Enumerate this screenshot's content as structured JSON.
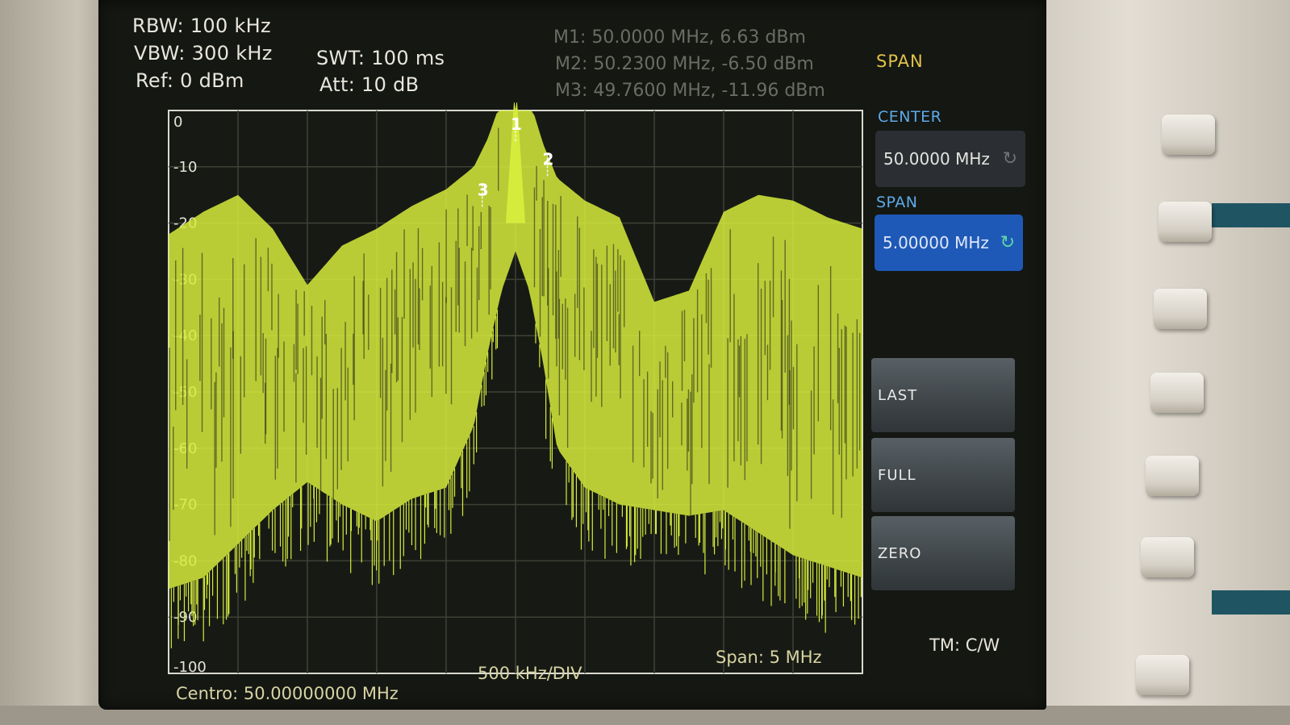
{
  "header": {
    "rbw": "RBW: 100 kHz",
    "vbw": "VBW: 300 kHz",
    "ref": "Ref: 0 dBm",
    "swt": "SWT: 100 ms",
    "att": "Att: 10 dB"
  },
  "markers_readout": {
    "m1": "M1: 50.0000 MHz, 6.63 dBm",
    "m2": "M2: 50.2300 MHz, -6.50 dBm",
    "m3": "M3: 49.7600 MHz, -11.96 dBm"
  },
  "menu": {
    "title": "SPAN",
    "center_label": "CENTER",
    "center_value": "50.0000 MHz",
    "span_label": "SPAN",
    "span_value": "5.00000 MHz",
    "buttons": [
      "LAST",
      "FULL",
      "ZERO"
    ]
  },
  "footer": {
    "center": "Centro: 50.00000000 MHz",
    "div": "500 kHz/DIV",
    "span": "Span: 5 MHz",
    "trigger_mode": "TM: C/W"
  },
  "colors": {
    "trace": "#d6ec3c",
    "grid": "#3d4236",
    "menu_title": "#e1c24a",
    "menu_label": "#5ea9e8",
    "selected_box": "#1f59b8"
  },
  "chart_data": {
    "type": "line",
    "title": "",
    "xlabel": "",
    "ylabel": "",
    "xlim": [
      47.5,
      52.5
    ],
    "ylim": [
      -100,
      0
    ],
    "y_ticks": [
      "0",
      "-10",
      "-20",
      "-30",
      "-40",
      "-50",
      "-60",
      "-70",
      "-80",
      "-90",
      "-100"
    ],
    "y_tick_values": [
      0,
      -10,
      -20,
      -30,
      -40,
      -50,
      -60,
      -70,
      -80,
      -90,
      -100
    ],
    "grid": true,
    "series": [
      {
        "x": [
          47.5,
          47.75,
          48.0,
          48.25,
          48.5,
          48.75,
          49.0,
          49.25,
          49.5,
          49.7,
          49.8,
          49.9,
          50.0,
          50.1,
          50.2,
          50.3,
          50.5,
          50.75,
          51.0,
          51.25,
          51.5,
          51.75,
          52.0,
          52.25,
          52.5
        ],
        "upper": [
          -22,
          -18,
          -15,
          -21,
          -31,
          -24,
          -21,
          -17,
          -14,
          -10,
          -5,
          2,
          6.6,
          2,
          -6,
          -12,
          -16,
          -19,
          -34,
          -32,
          -18,
          -15,
          -16,
          -19,
          -21
        ],
        "lower": [
          -85,
          -83,
          -77,
          -71,
          -66,
          -70,
          -73,
          -69,
          -67,
          -56,
          -43,
          -32,
          -25,
          -32,
          -45,
          -60,
          -67,
          -70,
          -71,
          -72,
          -71,
          -75,
          -79,
          -81,
          -83
        ]
      }
    ],
    "markers": [
      {
        "label": "1",
        "x": 50.0,
        "y": 6.63
      },
      {
        "label": "2",
        "x": 50.23,
        "y": -6.5
      },
      {
        "label": "3",
        "x": 49.76,
        "y": -11.96
      }
    ]
  }
}
